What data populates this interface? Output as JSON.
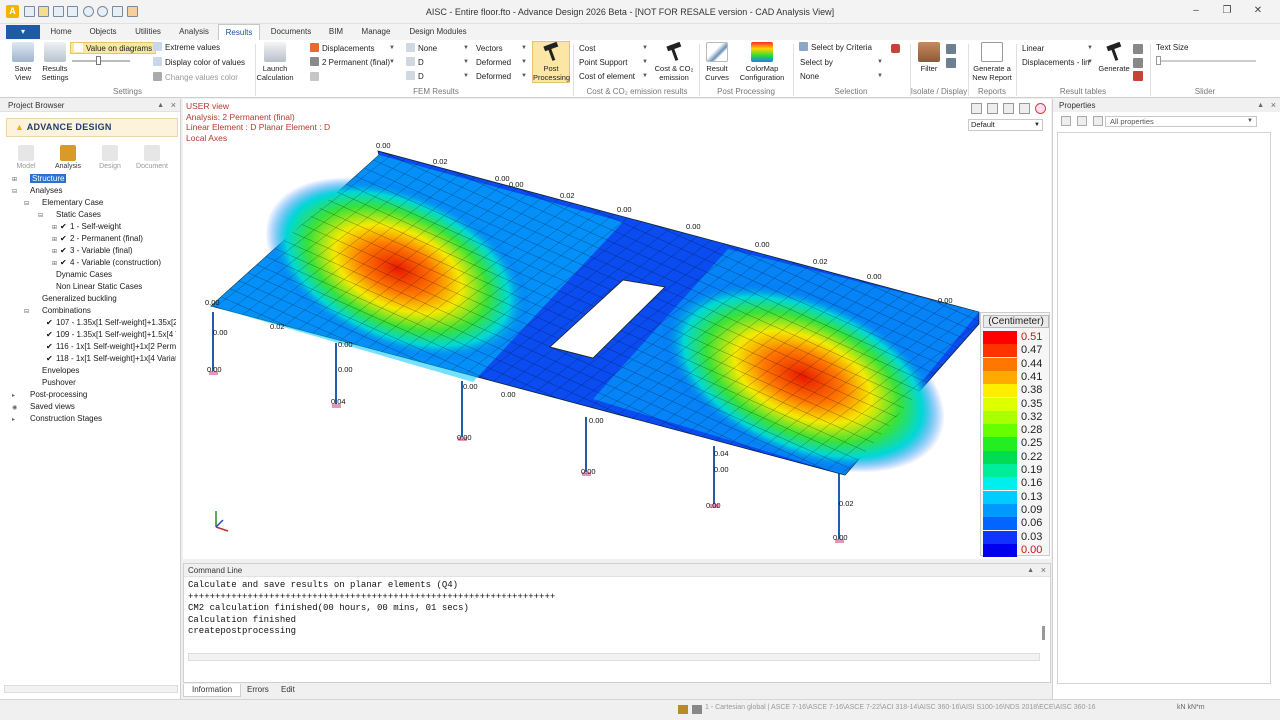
{
  "app": {
    "window_title": "AISC - Entire floor.fto - Advance Design 2026 Beta - [NOT FOR RESALE version - CAD Analysis View]",
    "file_button": "▾"
  },
  "tabs": [
    "Home",
    "Objects",
    "Utilities",
    "Analysis",
    "Results",
    "Documents",
    "BIM",
    "Manage",
    "Design Modules"
  ],
  "ribbon": {
    "settings": {
      "label": "Settings",
      "save_view": "Save View",
      "results_settings": "Results Settings",
      "value_on_diagrams": "Value on diagrams",
      "extreme_values": "Extreme values",
      "display_color_of_values": "Display color of values",
      "change_values_color": "Change values color"
    },
    "fem": {
      "label": "FEM Results",
      "launch": "Launch Calculation",
      "result_type": "Displacements",
      "case": "2 Permanent (final)",
      "none1": "None",
      "d1": "D",
      "d2": "D",
      "vectors": "Vectors",
      "deformed1": "Deformed",
      "deformed2": "Deformed",
      "post_processing": "Post Processing"
    },
    "cost": {
      "label": "Cost & CO₂ emission results",
      "cost": "Cost",
      "point_support": "Point Support",
      "cost_of_element": "Cost of element",
      "cost_co2": "Cost & CO₂ emission"
    },
    "post": {
      "label": "Post Processing",
      "result_curves": "Result Curves",
      "colormap": "ColorMap Configuration"
    },
    "selection": {
      "label": "Selection",
      "select_by_criteria": "Select by Criteria",
      "select_by": "Select by",
      "none": "None"
    },
    "isolate": {
      "label": "Isolate / Display",
      "filter": "Filter"
    },
    "reports": {
      "label": "Reports",
      "generate_report": "Generate a New Report"
    },
    "result_tables": {
      "label": "Result tables",
      "linear": "Linear",
      "displacements_lin": "Displacements - lin",
      "generate": "Generate"
    },
    "slider": {
      "label": "Slider",
      "text_size": "Text Size"
    }
  },
  "project_browser": {
    "title": "Project Browser",
    "logo": "ADVANCE DESIGN",
    "modes": [
      "Model",
      "Analysis",
      "Design",
      "Document"
    ],
    "tree": [
      {
        "label": "Structure",
        "depth": 0,
        "exp": "⊞",
        "selected": true
      },
      {
        "label": "Analyses",
        "depth": 0,
        "exp": "⊟"
      },
      {
        "label": "Elementary Case",
        "depth": 1,
        "exp": "⊟"
      },
      {
        "label": "Static Cases",
        "depth": 2,
        "exp": "⊟"
      },
      {
        "label": "1 - Self-weight",
        "depth": 3,
        "exp": "⊞",
        "check": "✔"
      },
      {
        "label": "2 - Permanent (final)",
        "depth": 3,
        "exp": "⊞",
        "check": "✔"
      },
      {
        "label": "3 - Variable (final)",
        "depth": 3,
        "exp": "⊞",
        "check": "✔"
      },
      {
        "label": "4 - Variable (construction)",
        "depth": 3,
        "exp": "⊞",
        "check": "✔"
      },
      {
        "label": "Dynamic Cases",
        "depth": 2
      },
      {
        "label": "Non Linear Static Cases",
        "depth": 2
      },
      {
        "label": "Generalized buckling",
        "depth": 1
      },
      {
        "label": "Combinations",
        "depth": 1,
        "exp": "⊟"
      },
      {
        "label": "107 - 1.35x[1 Self-weight]+1.35x[2",
        "depth": 2,
        "check": "✔"
      },
      {
        "label": "109 - 1.35x[1 Self-weight]+1.5x[4 V",
        "depth": 2,
        "check": "✔"
      },
      {
        "label": "116 - 1x[1 Self-weight]+1x[2 Perma",
        "depth": 2,
        "check": "✔"
      },
      {
        "label": "118 - 1x[1 Self-weight]+1x[4 Variat",
        "depth": 2,
        "check": "✔"
      },
      {
        "label": "Envelopes",
        "depth": 1
      },
      {
        "label": "Pushover",
        "depth": 1
      },
      {
        "label": "Post-processing",
        "depth": 0,
        "exp": "▸"
      },
      {
        "label": "Saved views",
        "depth": 0,
        "exp": "◉"
      },
      {
        "label": "Construction Stages",
        "depth": 0,
        "exp": "▸"
      }
    ]
  },
  "viewport": {
    "info": [
      "USER view",
      "Analysis: 2  Permanent (final)",
      "Linear Element : D Planar Element : D",
      "Local Axes"
    ],
    "view_combo": "Default",
    "labels": [
      {
        "t": "0.00"
      },
      {
        "t": "0.02"
      },
      {
        "t": "0.00"
      },
      {
        "t": "0.00"
      },
      {
        "t": "0.02"
      },
      {
        "t": "0.00"
      },
      {
        "t": "0.00"
      },
      {
        "t": "0.00"
      },
      {
        "t": "0.02"
      },
      {
        "t": "0.00"
      },
      {
        "t": "0.00"
      },
      {
        "t": "0.00"
      },
      {
        "t": "0.02"
      },
      {
        "t": "0.00"
      },
      {
        "t": "0.00"
      },
      {
        "t": "0.00"
      },
      {
        "t": "0.00"
      },
      {
        "t": "0.04"
      },
      {
        "t": "0.00"
      },
      {
        "t": "0.00"
      },
      {
        "t": "0.00"
      },
      {
        "t": "0.00"
      },
      {
        "t": "0.00"
      },
      {
        "t": "0.04"
      },
      {
        "t": "0.00"
      },
      {
        "t": "0.00"
      },
      {
        "t": "0.02"
      },
      {
        "t": "0.00"
      }
    ],
    "legend": {
      "title": "(Centimeter)",
      "values": [
        "0.51",
        "0.47",
        "0.44",
        "0.41",
        "0.38",
        "0.35",
        "0.32",
        "0.28",
        "0.25",
        "0.22",
        "0.19",
        "0.16",
        "0.13",
        "0.09",
        "0.06",
        "0.03",
        "0.00"
      ],
      "colors": [
        "#ff0000",
        "#ff3300",
        "#ff7700",
        "#ffaa00",
        "#ffee00",
        "#ddff00",
        "#aaff00",
        "#66ff00",
        "#22ee22",
        "#00dd55",
        "#00ee99",
        "#00eeee",
        "#00ccff",
        "#0099ff",
        "#0066ff",
        "#1133ff",
        "#0000ee"
      ]
    }
  },
  "properties": {
    "title": "Properties",
    "filter": "All properties"
  },
  "command_line": {
    "title": "Command Line",
    "lines": [
      "Calculate and save results on planar elements (Q4)",
      "++++++++++++++++++++++++++++++++++++++++++++++++++++++++++++++++++++",
      "CM2 calculation finished(00 hours, 00 mins, 01 secs)",
      "Calculation finished",
      "createpostprocessing"
    ],
    "tabs": [
      "Information",
      "Errors",
      "Edit"
    ]
  },
  "status": {
    "text": "1 - Cartesian global | ASCE 7-16\\ASCE 7-16\\ASCE 7-22\\ACI 318-14\\AISC 360-16\\AISI S100-16\\NDS 2018\\ECE\\AISC 360-16",
    "units": "kN  kN*m"
  }
}
